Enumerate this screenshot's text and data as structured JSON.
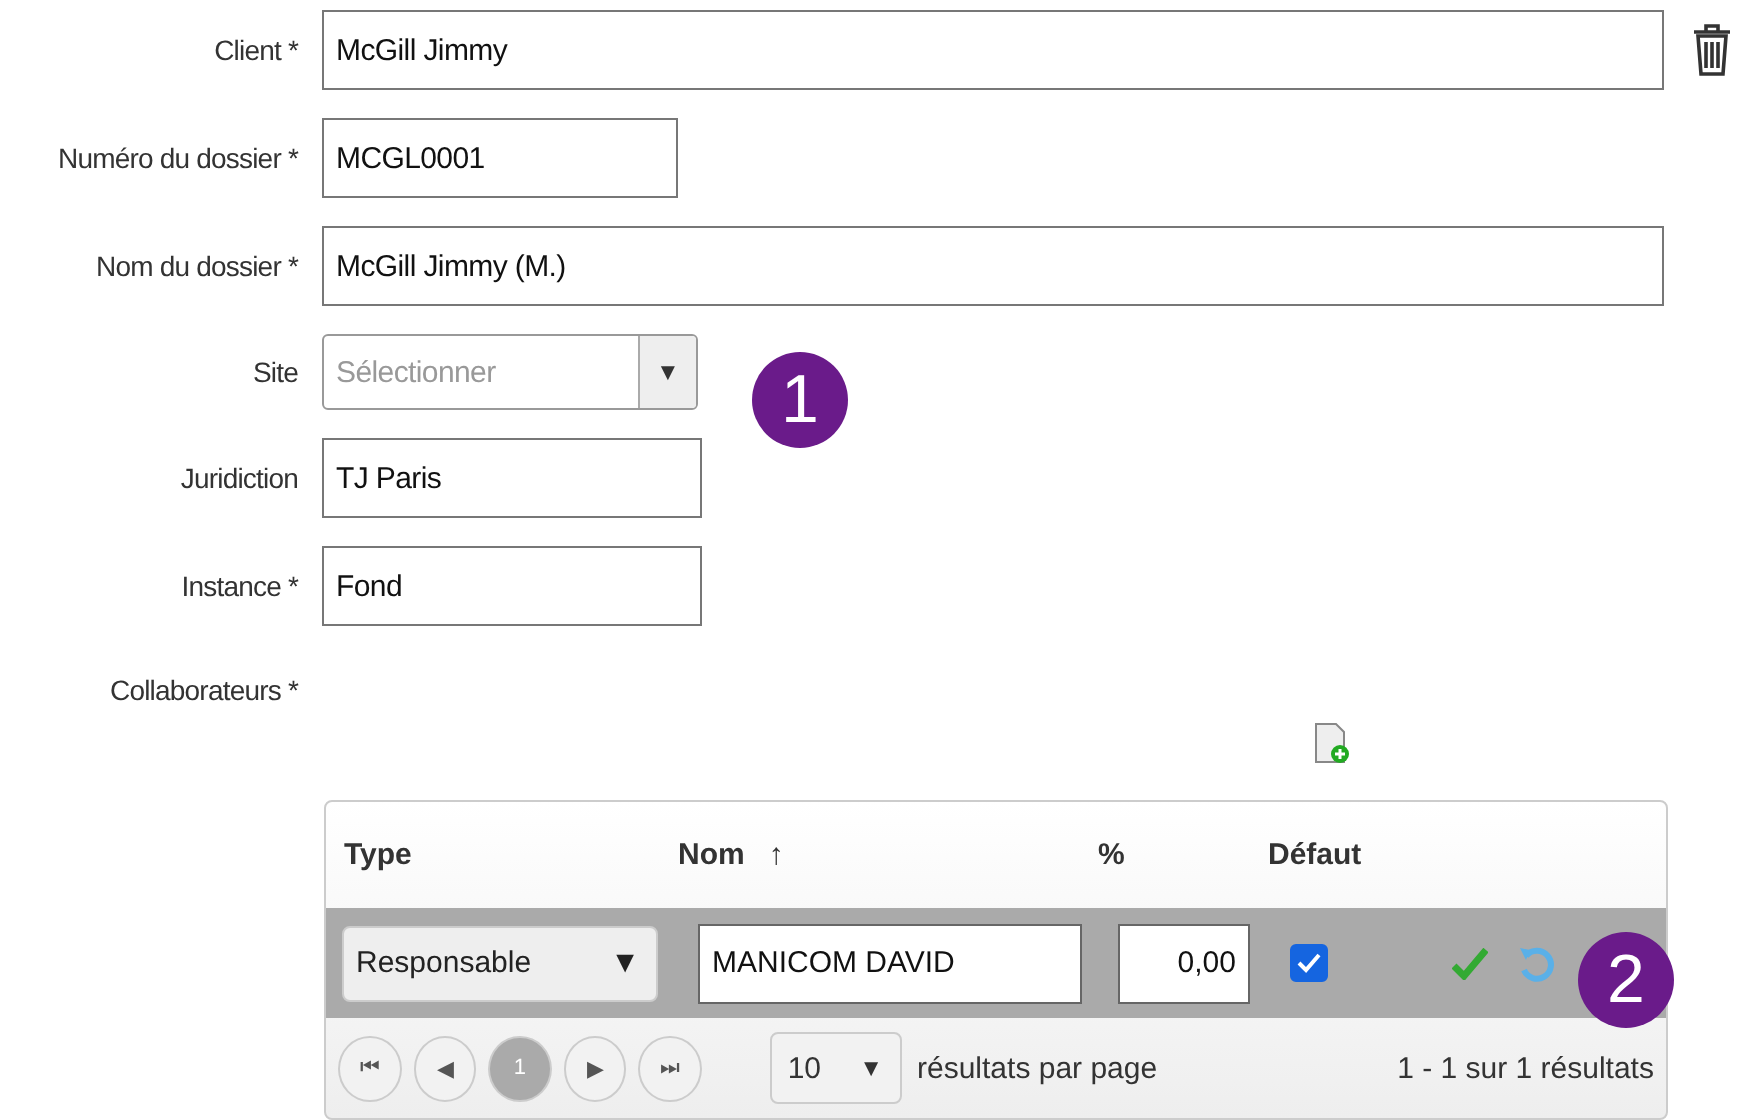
{
  "fields": [
    {
      "kind": "text",
      "label": "Client *",
      "value": "McGill Jimmy",
      "deletable": true
    },
    {
      "kind": "text",
      "label": "Numéro du dossier *",
      "value": "MCGL0001"
    },
    {
      "kind": "text",
      "label": "Nom du dossier *",
      "value": "McGill Jimmy (M.)"
    },
    {
      "kind": "select",
      "label": "Site",
      "placeholder": "Sélectionner",
      "caret": "▼"
    },
    {
      "kind": "text",
      "label": "Juridiction",
      "value": "TJ Paris"
    },
    {
      "kind": "text",
      "label": "Instance *",
      "value": "Fond"
    }
  ],
  "collaborators": {
    "label": "Collaborateurs *",
    "table": {
      "columns": [
        {
          "label": "Type"
        },
        {
          "label": "Nom",
          "sort": "↑"
        },
        {
          "label": "%"
        },
        {
          "label": "Défaut"
        }
      ],
      "rows": [
        {
          "type": "Responsable",
          "type_caret": "▼",
          "name": "MANICOM DAVID",
          "percent": "0,00",
          "default": true
        }
      ],
      "pager": {
        "first": "⏮",
        "prev": "◀",
        "page": "1",
        "next": "▶",
        "last": "⏭",
        "per_page": "10",
        "per_page_caret": "▼",
        "per_page_label": "résultats par page",
        "summary": "1 - 1 sur 1 résultats"
      }
    }
  },
  "badges": [
    "1",
    "2"
  ]
}
